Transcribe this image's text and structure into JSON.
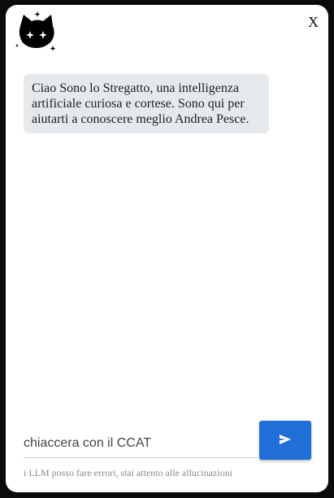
{
  "header": {
    "logo_icon": "cheshire-cat-icon",
    "close_label": "X"
  },
  "messages": [
    {
      "sender": "bot",
      "text": "Ciao Sono lo Stregatto, una intelligenza artificiale curiosa e cortese. Sono qui per aiutarti a conoscere meglio Andrea Pesce."
    }
  ],
  "composer": {
    "placeholder": "chiaccera con il CCAT",
    "value": "",
    "send_icon": "send-icon"
  },
  "footer": {
    "disclaimer": "i LLM posso fare errori, stai attento alle allucinazioni"
  },
  "colors": {
    "accent": "#1f6fd6",
    "bubble": "#e6e9ec",
    "background": "#ffffff"
  }
}
